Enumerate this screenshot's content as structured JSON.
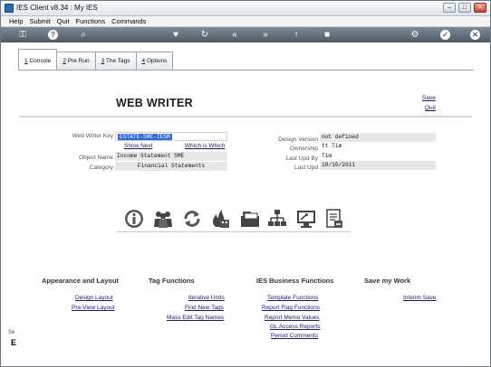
{
  "window": {
    "title": "IES Client v8.34 : My IES"
  },
  "menubar": {
    "items": [
      "Help",
      "Submit",
      "Quit",
      "Functions",
      "Commands"
    ]
  },
  "tabs": [
    {
      "num": "1",
      "label": "Console"
    },
    {
      "num": "2",
      "label": "Pre Run"
    },
    {
      "num": "3",
      "label": "The Tags"
    },
    {
      "num": "4",
      "label": "Options"
    }
  ],
  "header": {
    "title": "WEB WRITER",
    "save": "Save",
    "quit": "Quit"
  },
  "left_form": {
    "key_label": "Web Writer Key",
    "key_value": "ESTATE-SME-IESM",
    "show_next": "Show Next",
    "which_is_which": "Which is Which",
    "object_label": "Object Name",
    "object_value": "Income Statement SME",
    "category_label": "Category",
    "category_value": "Financial Statements"
  },
  "right_form": {
    "version_label": "Design Version",
    "version_value": "not defined",
    "owner_label": "Ownership",
    "owner_value": "tt Tim",
    "lastupdby_label": "Last Upd By",
    "lastupdby_value": "Tim",
    "lastupd_label": "Last Upd",
    "lastupd_value": "10/10/2011"
  },
  "icons": [
    "info-icon",
    "users-icon",
    "refresh-icon",
    "fire-icon",
    "folder-icon",
    "hierarchy-icon",
    "monitor-icon",
    "document-icon"
  ],
  "functions": {
    "appearance": {
      "title": "Appearance and Layout",
      "links": [
        "Design Layout",
        "Pre-View Layout"
      ]
    },
    "tags": {
      "title": "Tag Functions",
      "links": [
        "Iterative Units",
        "Find New Tags",
        "Mass Edit Tag Names"
      ]
    },
    "business": {
      "title": "IES Business Functions",
      "links": [
        "Template Functions",
        "Report Flag Functions",
        "Report Memo Values",
        "GL Access Reports",
        "Period Comments"
      ]
    },
    "save": {
      "title": "Save my Work",
      "links": [
        "Interim Save"
      ]
    }
  },
  "side": {
    "text": "Se",
    "letter": "E"
  },
  "colors": {
    "toolbar": "#5f6b77",
    "accent_blue": "#2b68d8",
    "link": "#1a1a66"
  }
}
